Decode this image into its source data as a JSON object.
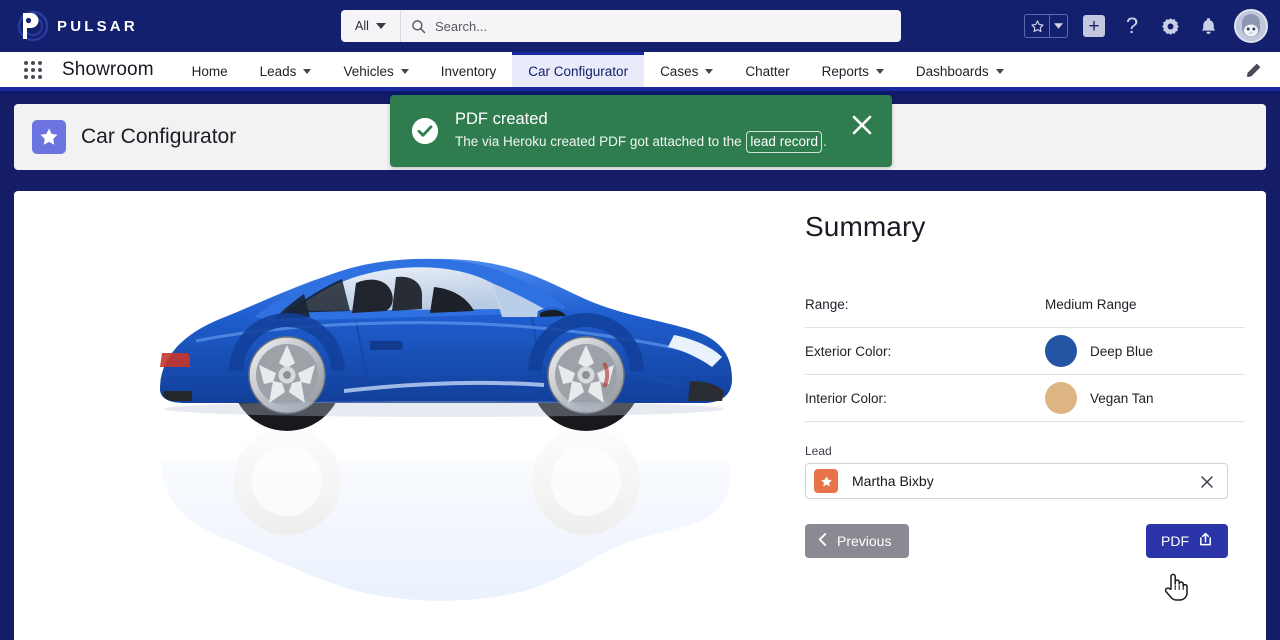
{
  "header": {
    "brand": "PULSAR",
    "brand_icon": "pulsar-logo-icon",
    "search": {
      "scope": "All",
      "scope_icon": "chevron-down-icon",
      "icon": "search-icon",
      "placeholder": "Search..."
    },
    "actions": [
      {
        "name": "favorites-star",
        "icon": "star-icon"
      },
      {
        "name": "favorites-caret",
        "icon": "chevron-down-icon"
      },
      {
        "name": "new-item",
        "icon": "plus-icon",
        "glyph": "+"
      },
      {
        "name": "help",
        "icon": "question-mark-icon",
        "glyph": "?"
      },
      {
        "name": "setup",
        "icon": "gear-icon"
      },
      {
        "name": "notifications",
        "icon": "bell-icon"
      },
      {
        "name": "user-profile",
        "icon": "avatar-icon"
      }
    ]
  },
  "nav": {
    "app_launcher_icon": "app-launcher-waffle-icon",
    "app_name": "Showroom",
    "edit_icon": "pencil-icon",
    "tabs": [
      {
        "label": "Home",
        "dropdown": false,
        "active": false
      },
      {
        "label": "Leads",
        "dropdown": true,
        "active": false
      },
      {
        "label": "Vehicles",
        "dropdown": true,
        "active": false
      },
      {
        "label": "Inventory",
        "dropdown": false,
        "active": false
      },
      {
        "label": "Car Configurator",
        "dropdown": false,
        "active": true
      },
      {
        "label": "Cases",
        "dropdown": true,
        "active": false
      },
      {
        "label": "Chatter",
        "dropdown": false,
        "active": false
      },
      {
        "label": "Reports",
        "dropdown": true,
        "active": false
      },
      {
        "label": "Dashboards",
        "dropdown": true,
        "active": false
      }
    ]
  },
  "page": {
    "icon": "star-badge-icon",
    "title": "Car Configurator"
  },
  "toast": {
    "variant": "success",
    "icon": "check-circle-icon",
    "title": "PDF created",
    "message_before": "The via Heroku created PDF got attached to the ",
    "link": "lead record",
    "message_after": ".",
    "close_icon": "close-icon",
    "background": "#2f7d4f"
  },
  "car": {
    "alt": "blue-sports-car-side-view",
    "body_color": "#1f5fd0",
    "body_color_dark": "#123f9a",
    "body_color_light": "#4d8bf0"
  },
  "summary": {
    "title": "Summary",
    "specs": [
      {
        "label": "Range:",
        "value": "Medium Range",
        "swatch": null
      },
      {
        "label": "Exterior Color:",
        "value": "Deep Blue",
        "swatch": "#2455a4"
      },
      {
        "label": "Interior Color:",
        "value": "Vegan Tan",
        "swatch": "#dcb583"
      }
    ],
    "lead": {
      "label": "Lead",
      "value": "Martha Bixby",
      "avatar_icon": "lead-star-icon",
      "avatar_color": "#e8734a",
      "clear_icon": "close-icon"
    },
    "buttons": {
      "previous": {
        "label": "Previous",
        "icon": "chevron-left-icon",
        "color": "#8a8a92"
      },
      "pdf": {
        "label": "PDF",
        "icon": "share-export-icon",
        "color": "#2b34a8"
      }
    }
  },
  "cursor": {
    "icon": "pointer-hand-cursor"
  }
}
